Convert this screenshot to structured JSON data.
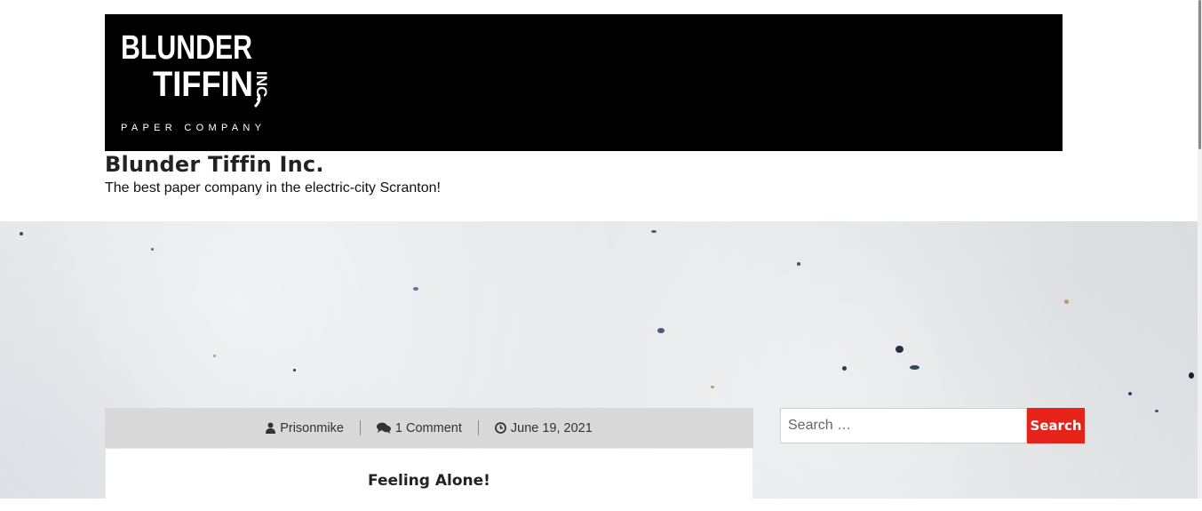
{
  "header": {
    "logo": {
      "line1": "BLUNDER",
      "line2": "TIFFIN",
      "suffix": "INC.",
      "tagline": "PAPER COMPANY"
    },
    "site_title": "Blunder Tiffin Inc.",
    "site_description": "The best paper company in the electric-city Scranton!"
  },
  "post": {
    "author": "Prisonmike",
    "comments": "1 Comment",
    "date": "June 19, 2021",
    "title": "Feeling Alone!"
  },
  "search": {
    "placeholder": "Search …",
    "button_label": "Search"
  },
  "colors": {
    "banner": "#000000",
    "accent": "#e5231b",
    "meta_bar": "#d9d9d9"
  },
  "icons": {
    "author": "user-icon",
    "comments": "comments-icon",
    "date": "clock-icon"
  }
}
